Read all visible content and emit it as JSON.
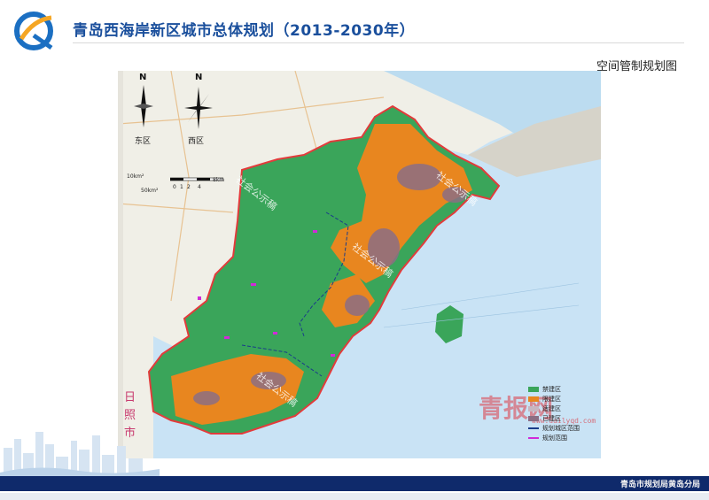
{
  "header": {
    "title": "青岛西海岸新区城市总体规划（2013-2030年）",
    "subtitle": "空间管制规划图"
  },
  "map": {
    "compass_left": {
      "north": "N",
      "label": "东区"
    },
    "compass_right": {
      "north": "N",
      "label": "西区"
    },
    "scale": {
      "area_1": "10km²",
      "area_2": "50km²",
      "ticks": [
        "0",
        "1",
        "2",
        "4",
        "8km"
      ]
    },
    "district_label": "日照市",
    "notices": [
      "社会公示稿",
      "社会公示稿",
      "社会公示稿",
      "社会公示稿"
    ],
    "watermark": "青报网",
    "watermark_url": "www.dailyqd.com",
    "legend": [
      {
        "label": "禁建区",
        "color": "#3aa55a",
        "kind": "box"
      },
      {
        "label": "限建区",
        "color": "#e8861f",
        "kind": "box"
      },
      {
        "label": "适建区",
        "color": "#c8b6c0",
        "kind": "box"
      },
      {
        "label": "已建区",
        "color": "#8c6e84",
        "kind": "box"
      },
      {
        "label": "规划城区范围",
        "color": "#1a3c8a",
        "kind": "dashed"
      },
      {
        "label": "规划范围",
        "color": "#d12ad8",
        "kind": "dashed"
      }
    ],
    "colors": {
      "sea": "#c9e3f5",
      "land_base": "#f0efe7",
      "forbidden": "#3aa55a",
      "restricted": "#e8861f",
      "built": "#8c6e84",
      "boundary": "#e23b3b"
    }
  },
  "footer": {
    "text": "青岛市规划局黄岛分局"
  }
}
